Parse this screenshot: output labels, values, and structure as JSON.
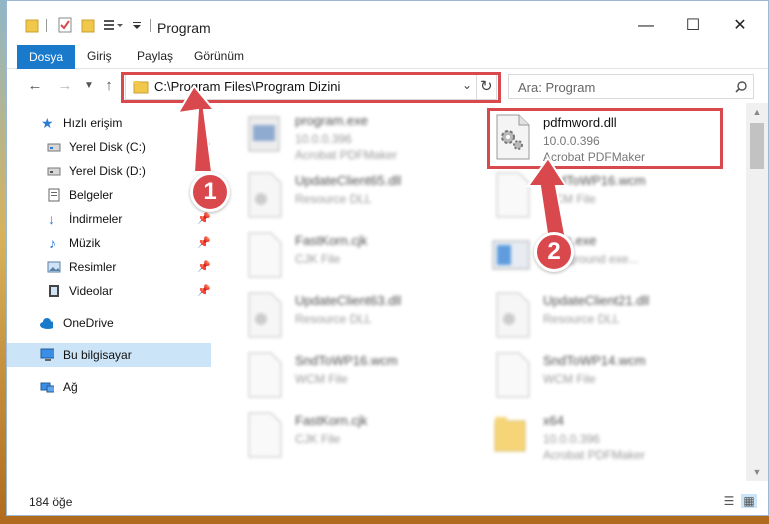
{
  "window": {
    "title": "Program"
  },
  "ribbon": {
    "tabs": [
      "Dosya",
      "Giriş",
      "Paylaş",
      "Görünüm"
    ]
  },
  "address": {
    "path": "C:\\Program Files\\Program Dizini"
  },
  "search": {
    "placeholder": "Ara: Program"
  },
  "sidebar": {
    "items": [
      {
        "label": "Hızlı erişim"
      },
      {
        "label": "Yerel Disk (C:)"
      },
      {
        "label": "Yerel Disk (D:)"
      },
      {
        "label": "Belgeler"
      },
      {
        "label": "İndirmeler"
      },
      {
        "label": "Müzik"
      },
      {
        "label": "Resimler"
      },
      {
        "label": "Videolar"
      },
      {
        "label": "OneDrive"
      },
      {
        "label": "Bu bilgisayar"
      },
      {
        "label": "Ağ"
      }
    ]
  },
  "files": [
    {
      "name": "program.exe",
      "l2": "10.0.0.396",
      "l3": "Acrobat PDFMaker"
    },
    {
      "name": "pdfmword.dll",
      "l2": "10.0.0.396",
      "l3": "Acrobat PDFMaker"
    },
    {
      "name": "UpdateClient65.dll",
      "l2": "Resource DLL",
      "l3": ""
    },
    {
      "name": "SndToWP16.wcm",
      "l2": "WCM File",
      "l3": ""
    },
    {
      "name": "FastKorn.cjk",
      "l2": "CJK File",
      "l3": ""
    },
    {
      "name": "Exec.exe",
      "l2": "background exe...",
      "l3": ""
    },
    {
      "name": "UpdateClient63.dll",
      "l2": "Resource DLL",
      "l3": ""
    },
    {
      "name": "UpdateClient21.dll",
      "l2": "Resource DLL",
      "l3": ""
    },
    {
      "name": "SndToWP16.wcm",
      "l2": "WCM File",
      "l3": ""
    },
    {
      "name": "SndToWP14.wcm",
      "l2": "WCM File",
      "l3": ""
    },
    {
      "name": "FastKorn.cjk",
      "l2": "CJK File",
      "l3": ""
    },
    {
      "name": "x64",
      "l2": "10.0.0.396",
      "l3": "Acrobat PDFMaker"
    }
  ],
  "status": {
    "count": "184 öğe"
  },
  "annotations": {
    "m1": "1",
    "m2": "2"
  },
  "colors": {
    "accent": "#1979ca",
    "highlight": "#d8484d",
    "selected": "#cce4f7"
  }
}
